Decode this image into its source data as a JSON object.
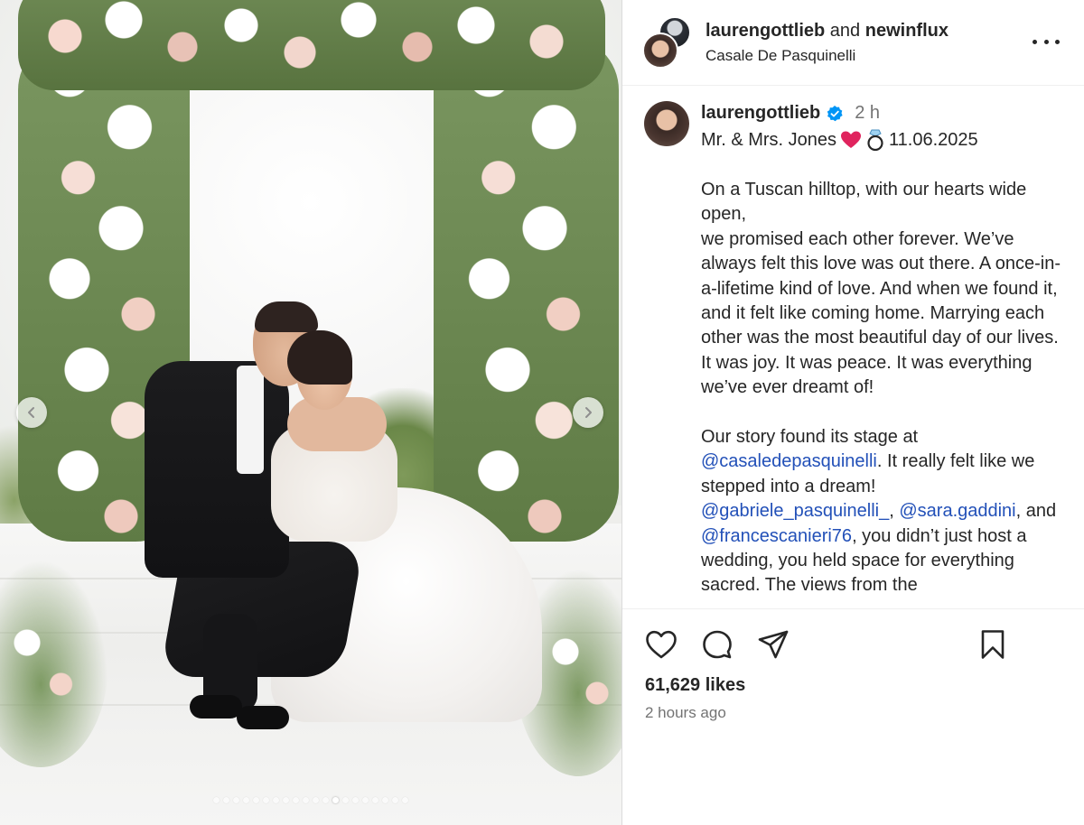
{
  "post": {
    "header": {
      "user1": "laurengottlieb",
      "and_text": "and",
      "user2": "newinflux",
      "location": "Casale De Pasquinelli"
    },
    "caption": {
      "username": "laurengottlieb",
      "time": "2 h",
      "line_text": "Mr. & Mrs. Jones",
      "date": "11.06.2025",
      "p1": "On a Tuscan hilltop, with our hearts wide open,",
      "p2": "we promised each other forever. We’ve always felt this love was out there. A once-in-a-lifetime kind of love. And when we found it, and it felt like coming home. Marrying each other was the most beautiful day of our lives. It was joy. It was peace. It was everything we’ve ever dreamt of!",
      "p3_pre": "Our story found its stage at ",
      "p3_mention1": "@casaledepasquinelli",
      "p3_mid": ". It really felt like we stepped into a dream!",
      "p4_mention1": "@gabriele_pasquinelli_",
      "p4_sep1": ", ",
      "p4_mention2": "@sara.gaddini",
      "p4_sep2": ",",
      "p4_and": "and ",
      "p4_mention3": "@francescanieri76",
      "p4_rest": ", you didn’t just host a wedding, you held space for everything sacred. The views from the"
    },
    "likes": "61,629 likes",
    "posted_ago": "2 hours ago",
    "carousel": {
      "total": 20,
      "active_index": 12
    },
    "icons": [
      "heart-icon",
      "comment-icon",
      "share-icon",
      "bookmark-icon",
      "more-icon",
      "verified-icon",
      "chevron-left-icon",
      "chevron-right-icon"
    ],
    "colors": {
      "mention": "#2250b8",
      "verified": "#0095f6",
      "heart_emoji": "#e0245e",
      "muted": "#737373"
    }
  }
}
